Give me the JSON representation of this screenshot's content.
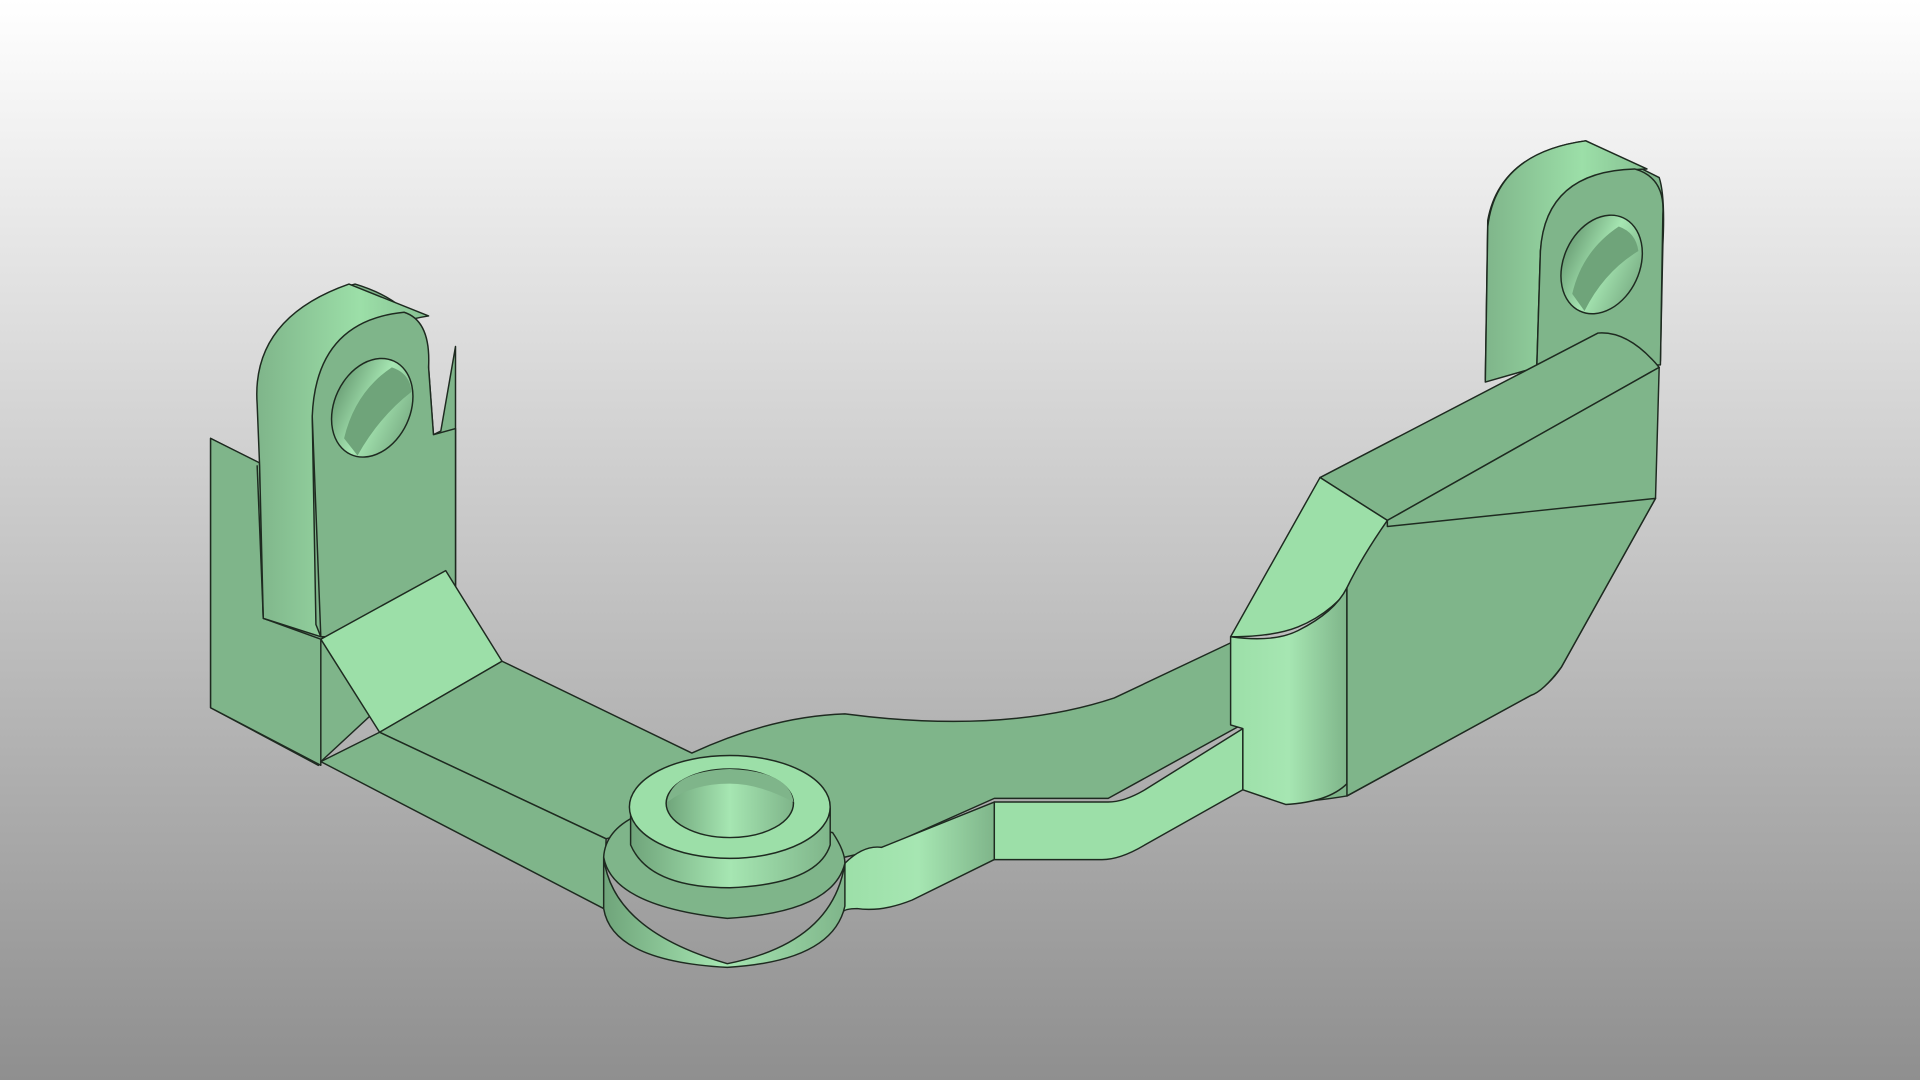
{
  "viewport": {
    "background_top": "#ffffff",
    "background_bottom": "#8f8f8f",
    "model_name": "green-mounting-bracket"
  },
  "colors": {
    "face_top": "#9cdfa8",
    "face_side": "#7fb58a",
    "face_shadow": "#6fa47a",
    "face_highlight": "#a6e6b2",
    "edge": "#1e2a20"
  }
}
